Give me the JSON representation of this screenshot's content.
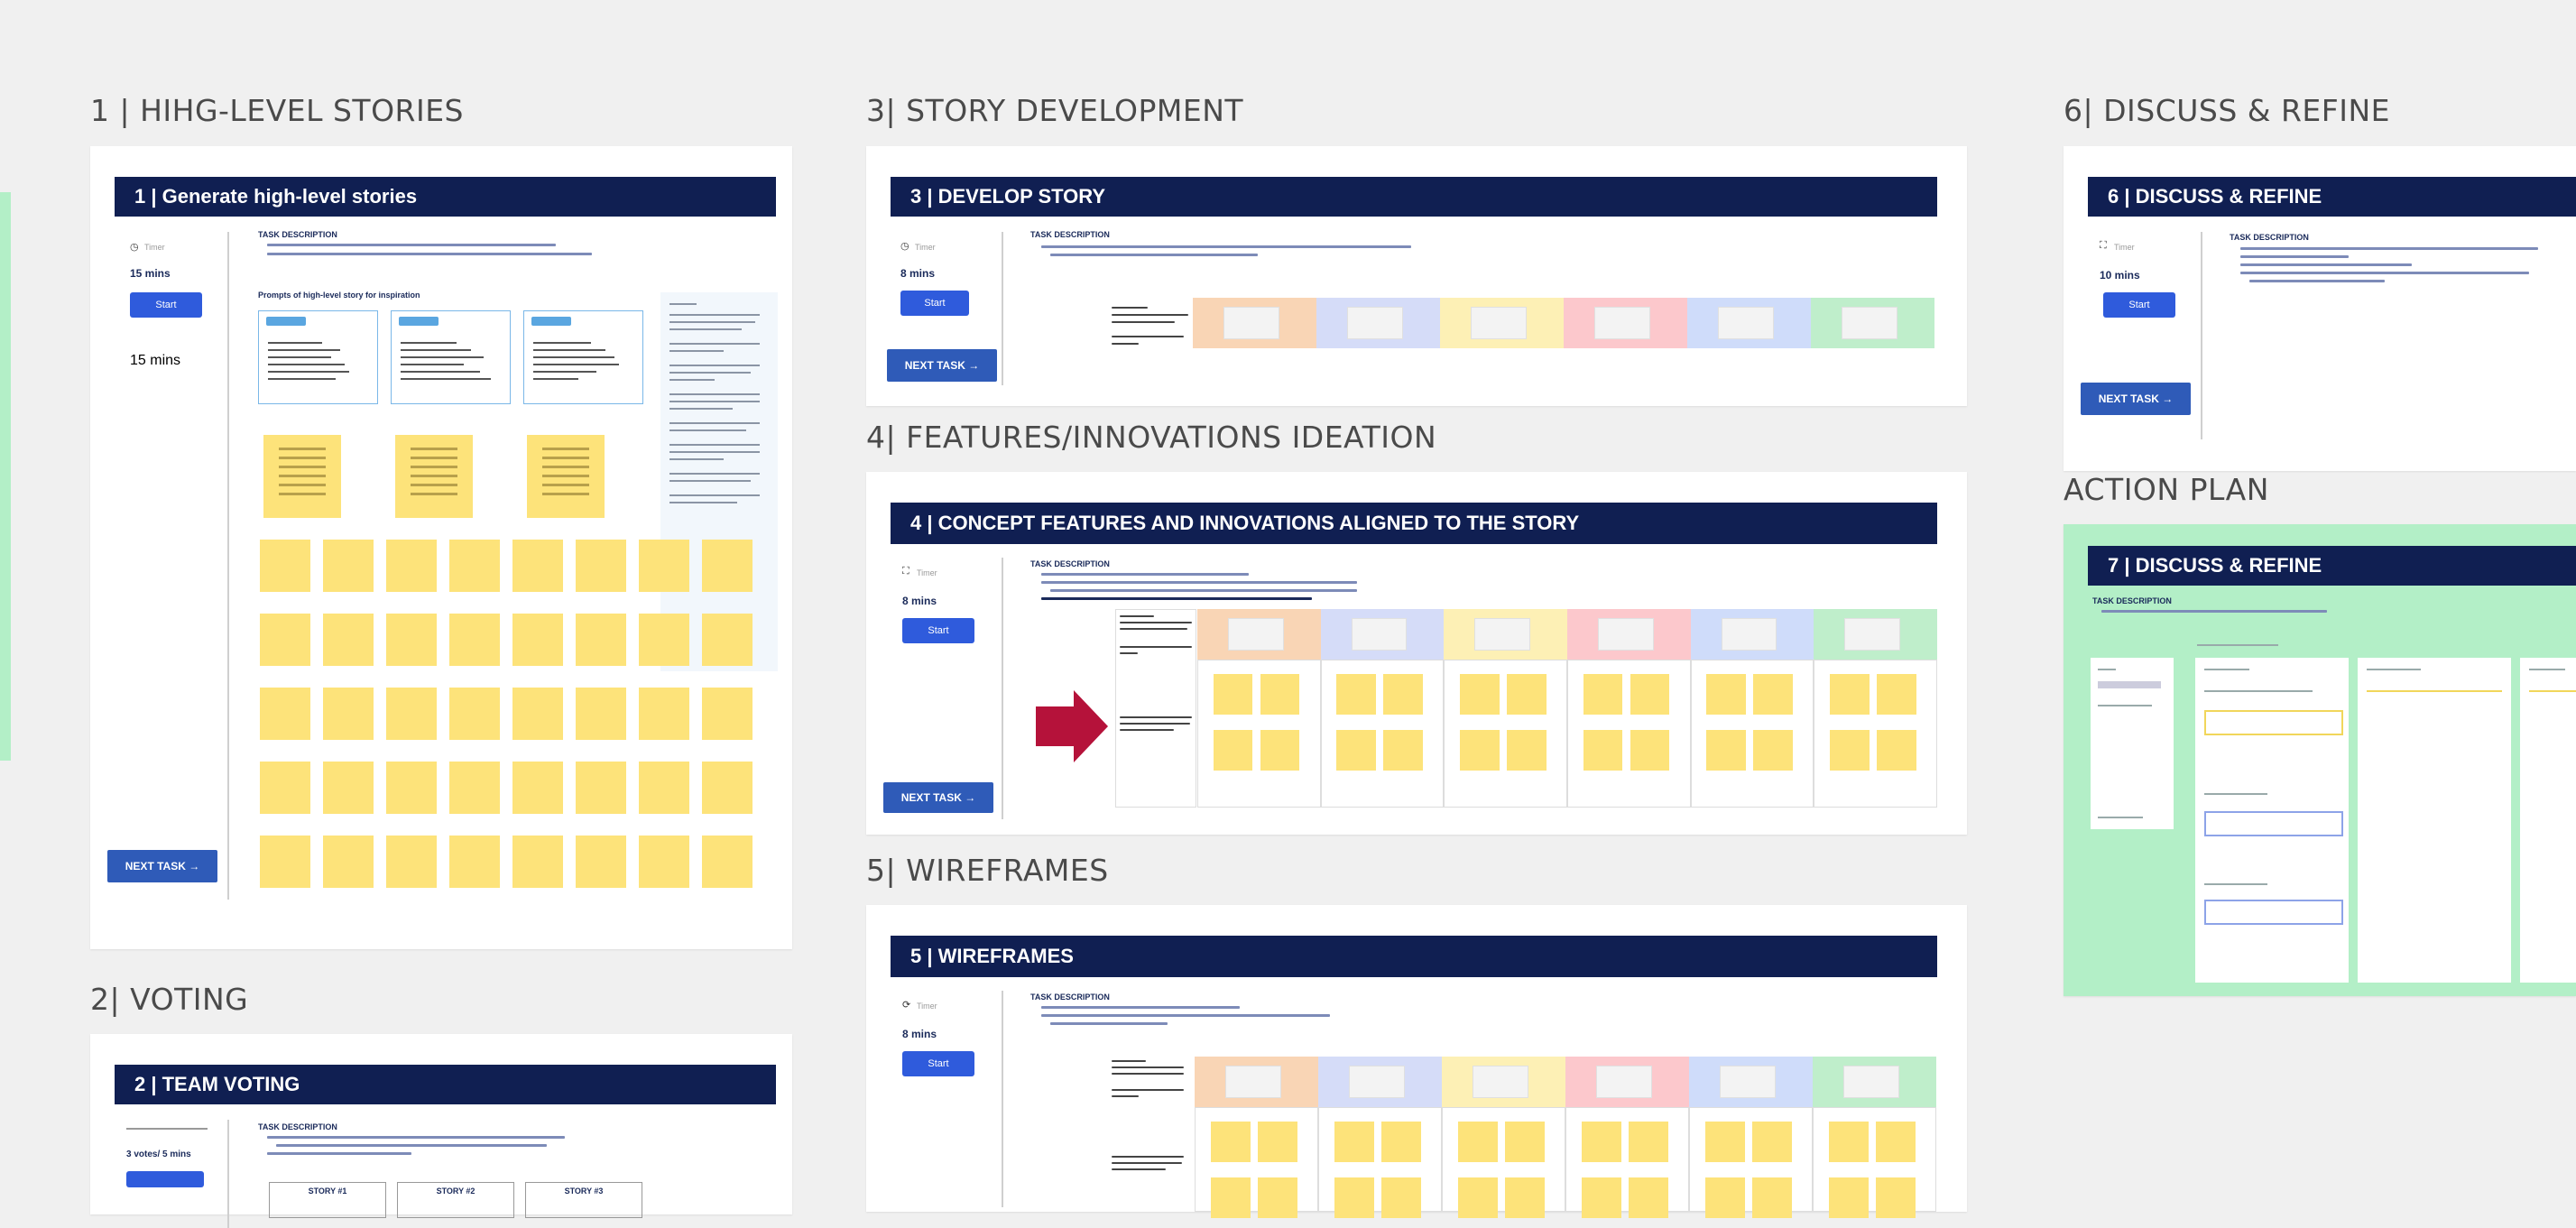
{
  "sections": {
    "s1": "1 | HIHG-LEVEL STORIES",
    "s2": "2| VOTING",
    "s3": "3| STORY DEVELOPMENT",
    "s4": "4| FEATURES/INNOVATIONS IDEATION",
    "s5": "5| WIREFRAMES",
    "s6": "6| DISCUSS & REFINE",
    "s7": "ACTION PLAN"
  },
  "frames": {
    "f1": {
      "header": "1 | Generate high-level stories",
      "mins": "15 mins",
      "start": "Start",
      "timer_label": "Timer",
      "desc_title": "TASK DESCRIPTION",
      "subheading": "Prompts of high-level story for inspiration",
      "next": "NEXT TASK →"
    },
    "f2": {
      "header": "2 | TEAM VOTING",
      "mins": "3 votes/ 5 mins",
      "desc_title": "TASK DESCRIPTION",
      "story_labels": [
        "STORY #1",
        "STORY #2",
        "STORY #3"
      ]
    },
    "f3": {
      "header": "3 | DEVELOP STORY",
      "mins": "8 mins",
      "start": "Start",
      "timer_label": "Timer",
      "desc_title": "TASK DESCRIPTION",
      "next": "NEXT TASK →"
    },
    "f4": {
      "header": "4 | CONCEPT FEATURES AND INNOVATIONS ALIGNED TO THE STORY",
      "mins": "8 mins",
      "start": "Start",
      "timer_label": "Timer",
      "desc_title": "TASK DESCRIPTION",
      "next": "NEXT TASK →"
    },
    "f5": {
      "header": "5 | WIREFRAMES",
      "mins": "8 mins",
      "start": "Start",
      "timer_label": "Timer",
      "desc_title": "TASK DESCRIPTION"
    },
    "f6": {
      "header": "6 | DISCUSS & REFINE",
      "mins": "10 mins",
      "start": "Start",
      "timer_label": "Timer",
      "desc_title": "TASK DESCRIPTION",
      "next": "NEXT TASK →"
    },
    "f7": {
      "header": "7 | DISCUSS & REFINE",
      "desc_title": "TASK DESCRIPTION"
    }
  },
  "colors": {
    "header_bg": "#101f52",
    "sticky": "#fde37a",
    "band_colors": [
      "#f9d5b5",
      "#d5dcf8",
      "#fdf0b5",
      "#fcc8cc",
      "#cfdcfa",
      "#bfeecb"
    ],
    "arrow": "#b5123a",
    "action_plan_bg": "#b3efc7",
    "button": "#2f5bdc"
  },
  "icons": [
    "timer-icon",
    "arrow-right-icon",
    "red-arrow-icon"
  ]
}
